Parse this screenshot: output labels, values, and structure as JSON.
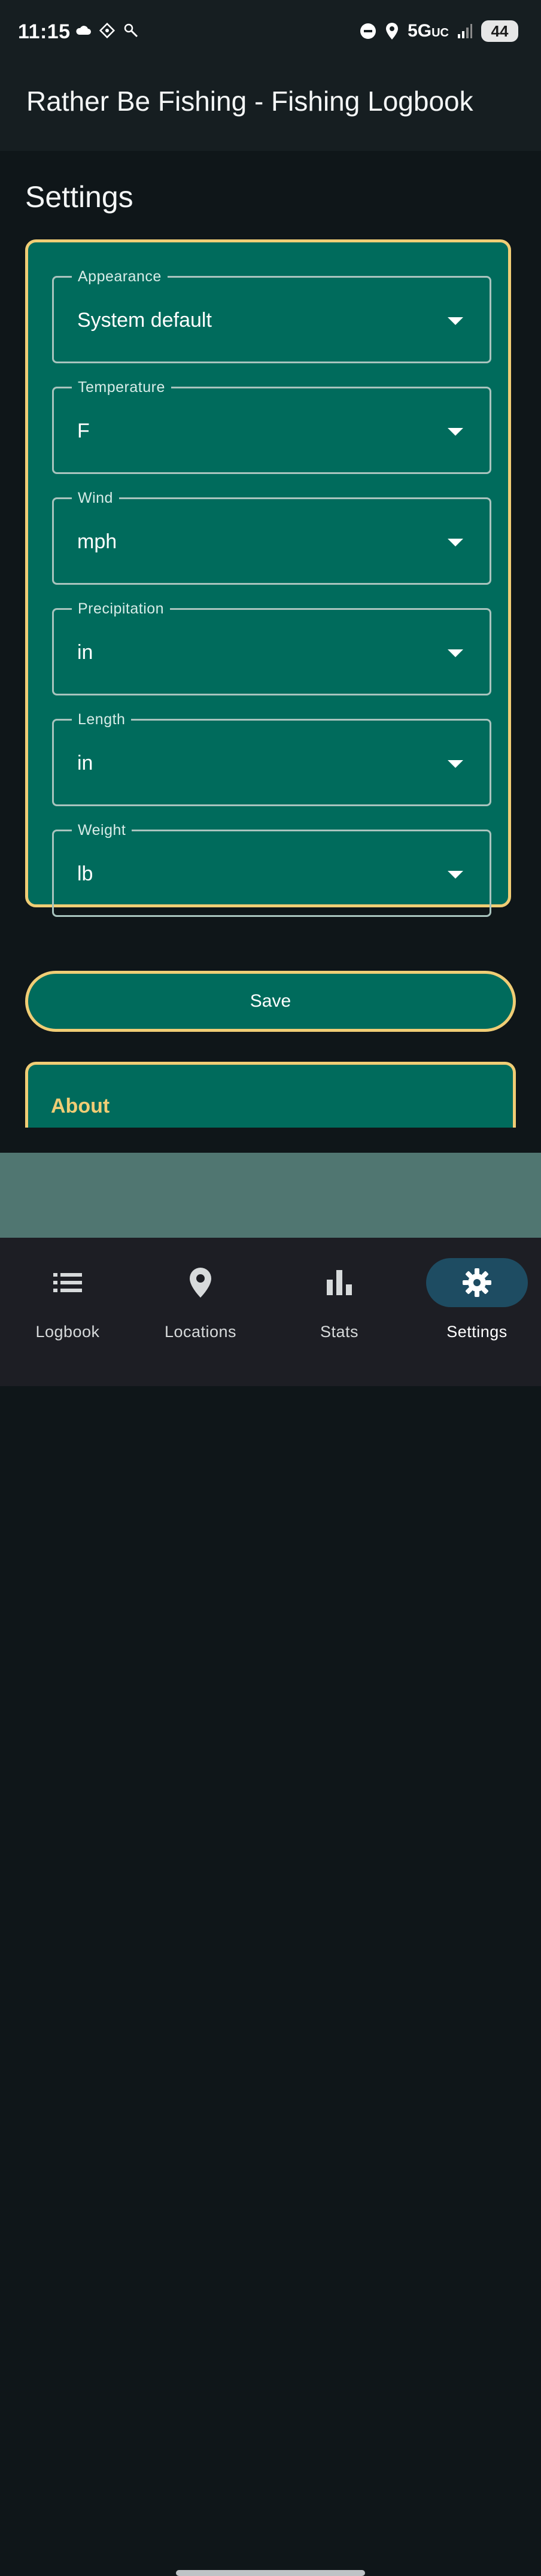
{
  "status_bar": {
    "time": "11:15",
    "network": "5G",
    "network_suffix": "UC",
    "battery": "44",
    "icons": [
      "cloud-icon",
      "app-icon",
      "flashlight-icon",
      "dnd-icon",
      "location-icon",
      "signal-icon",
      "battery-icon"
    ]
  },
  "app": {
    "title": "Rather Be Fishing - Fishing Logbook"
  },
  "page": {
    "title": "Settings"
  },
  "settings": {
    "fields": [
      {
        "label": "Appearance",
        "value": "System default"
      },
      {
        "label": "Temperature",
        "value": "F"
      },
      {
        "label": "Wind",
        "value": "mph"
      },
      {
        "label": "Precipitation",
        "value": "in"
      },
      {
        "label": "Length",
        "value": "in"
      },
      {
        "label": "Weight",
        "value": "lb"
      }
    ],
    "save_label": "Save"
  },
  "about": {
    "title": "About"
  },
  "bottom_nav": {
    "items": [
      {
        "label": "Logbook",
        "icon": "list-icon",
        "active": false
      },
      {
        "label": "Locations",
        "icon": "location-pin-icon",
        "active": false
      },
      {
        "label": "Stats",
        "icon": "bar-chart-icon",
        "active": false
      },
      {
        "label": "Settings",
        "icon": "gear-icon",
        "active": true
      }
    ]
  },
  "colors": {
    "card_bg": "#006b5c",
    "accent": "#f0cd75",
    "nav_active": "#1e4c62"
  }
}
